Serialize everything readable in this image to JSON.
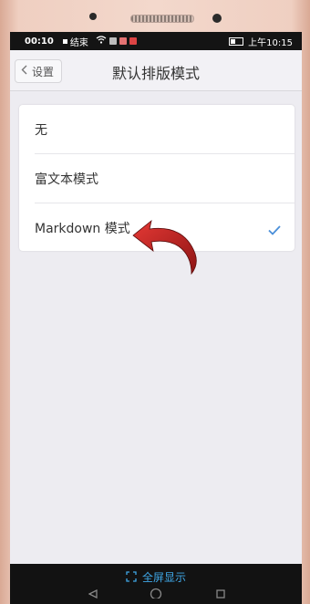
{
  "statusbar": {
    "time": "00:10",
    "end_label": "结束",
    "clock_right": "上午10:15"
  },
  "navbar": {
    "back_label": "设置",
    "title": "默认排版模式"
  },
  "options": [
    {
      "label": "无",
      "selected": false
    },
    {
      "label": "富文本模式",
      "selected": false
    },
    {
      "label": "Markdown 模式",
      "selected": true
    }
  ],
  "bottom": {
    "fullscreen_label": "全屏显示"
  },
  "colors": {
    "check": "#4a8fd9",
    "arrow": "#c62828",
    "fullscreen": "#3fa7e6"
  }
}
